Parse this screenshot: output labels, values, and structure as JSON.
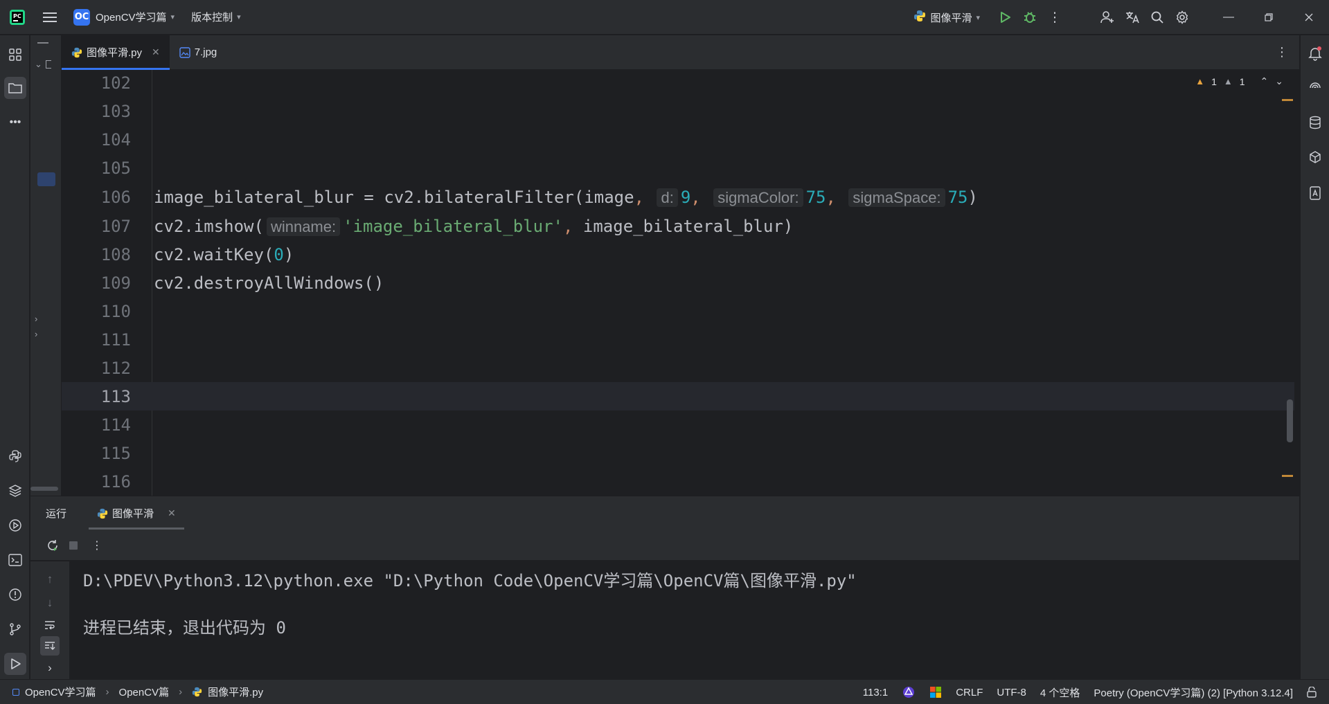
{
  "titlebar": {
    "project_badge": "OC",
    "project_name": "OpenCV学习篇",
    "vcs_label": "版本控制",
    "run_config": "图像平滑"
  },
  "tabs": [
    {
      "label": "图像平滑.py",
      "icon": "python-file-icon",
      "active": true
    },
    {
      "label": "7.jpg",
      "icon": "image-file-icon",
      "active": false
    }
  ],
  "editor": {
    "warnings_count": "1",
    "weak_warnings_count": "1",
    "lines": [
      {
        "num": "102"
      },
      {
        "num": "103"
      },
      {
        "num": "104"
      },
      {
        "num": "105"
      },
      {
        "num": "106"
      },
      {
        "num": "107"
      },
      {
        "num": "108"
      },
      {
        "num": "109"
      },
      {
        "num": "110"
      },
      {
        "num": "111"
      },
      {
        "num": "112"
      },
      {
        "num": "113"
      },
      {
        "num": "114"
      },
      {
        "num": "115"
      },
      {
        "num": "116"
      }
    ],
    "code106": {
      "prefix": "image_bilateral_blur = cv2.bilateralFilter(image",
      "comma": ",",
      "hint_d": "d:",
      "val_d": "9",
      "hint_sc": "sigmaColor:",
      "val_sc": "75",
      "hint_ss": "sigmaSpace:",
      "val_ss": "75",
      "close": ")"
    },
    "code107": {
      "prefix": "cv2.imshow(",
      "hint": "winname:",
      "str": "'image_bilateral_blur'",
      "comma": ",",
      "rest": " image_bilateral_blur)"
    },
    "code108": {
      "prefix": "cv2.waitKey(",
      "num": "0",
      "close": ")"
    },
    "code109": "cv2.destroyAllWindows()"
  },
  "run_panel": {
    "title": "运行",
    "tab_label": "图像平滑",
    "console": [
      "D:\\PDEV\\Python3.12\\python.exe \"D:\\Python Code\\OpenCV学习篇\\OpenCV篇\\图像平滑.py\"",
      "进程已结束，退出代码为 0"
    ]
  },
  "statusbar": {
    "breadcrumb": [
      "OpenCV学习篇",
      "OpenCV篇",
      "图像平滑.py"
    ],
    "position": "113:1",
    "line_ending": "CRLF",
    "encoding": "UTF-8",
    "indent": "4 个空格",
    "interpreter": "Poetry (OpenCV学习篇) (2) [Python 3.12.4]"
  },
  "colors": {
    "accent": "#3574f0",
    "background": "#1e1f22",
    "panel": "#2b2d30",
    "run_green": "#5fb865",
    "warning": "#e8a33e"
  }
}
